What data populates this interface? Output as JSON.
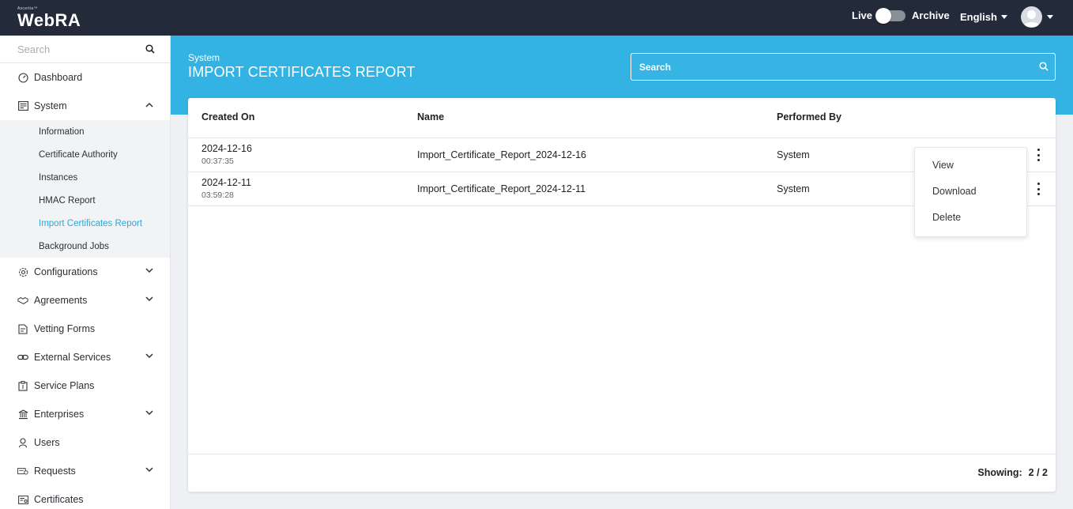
{
  "topbar": {
    "logo_small": "Ascertia™",
    "logo_main": "WebRA",
    "toggle_left": "Live",
    "toggle_right": "Archive",
    "language": "English"
  },
  "sidebar": {
    "search_placeholder": "Search",
    "items": [
      {
        "label": "Dashboard",
        "icon": "dashboard-icon"
      },
      {
        "label": "System",
        "icon": "system-icon",
        "expanded": true,
        "children": [
          {
            "label": "Information"
          },
          {
            "label": "Certificate Authority"
          },
          {
            "label": "Instances"
          },
          {
            "label": "HMAC Report"
          },
          {
            "label": "Import Certificates Report",
            "active": true
          },
          {
            "label": "Background Jobs"
          }
        ]
      },
      {
        "label": "Configurations",
        "icon": "gear-icon"
      },
      {
        "label": "Agreements",
        "icon": "handshake-icon"
      },
      {
        "label": "Vetting Forms",
        "icon": "form-icon"
      },
      {
        "label": "External Services",
        "icon": "link-icon"
      },
      {
        "label": "Service Plans",
        "icon": "plan-icon"
      },
      {
        "label": "Enterprises",
        "icon": "bank-icon"
      },
      {
        "label": "Users",
        "icon": "user-icon"
      },
      {
        "label": "Requests",
        "icon": "request-icon"
      },
      {
        "label": "Certificates",
        "icon": "certificate-icon"
      }
    ]
  },
  "header": {
    "breadcrumb": "System",
    "title": "IMPORT CERTIFICATES REPORT",
    "search_placeholder": "Search"
  },
  "table": {
    "columns": [
      "Created On",
      "Name",
      "Performed By"
    ],
    "rows": [
      {
        "date": "2024-12-16",
        "time": "00:37:35",
        "name": "Import_Certificate_Report_2024-12-16",
        "performed_by": "System"
      },
      {
        "date": "2024-12-11",
        "time": "03:59:28",
        "name": "Import_Certificate_Report_2024-12-11",
        "performed_by": "System"
      }
    ]
  },
  "menu": {
    "items": [
      "View",
      "Download",
      "Delete"
    ]
  },
  "footer": {
    "showing_label": "Showing:",
    "showing_value": "2 / 2"
  },
  "colors": {
    "topbar": "#232b3b",
    "accent": "#33b3e3",
    "active_link": "#29a8d8"
  }
}
